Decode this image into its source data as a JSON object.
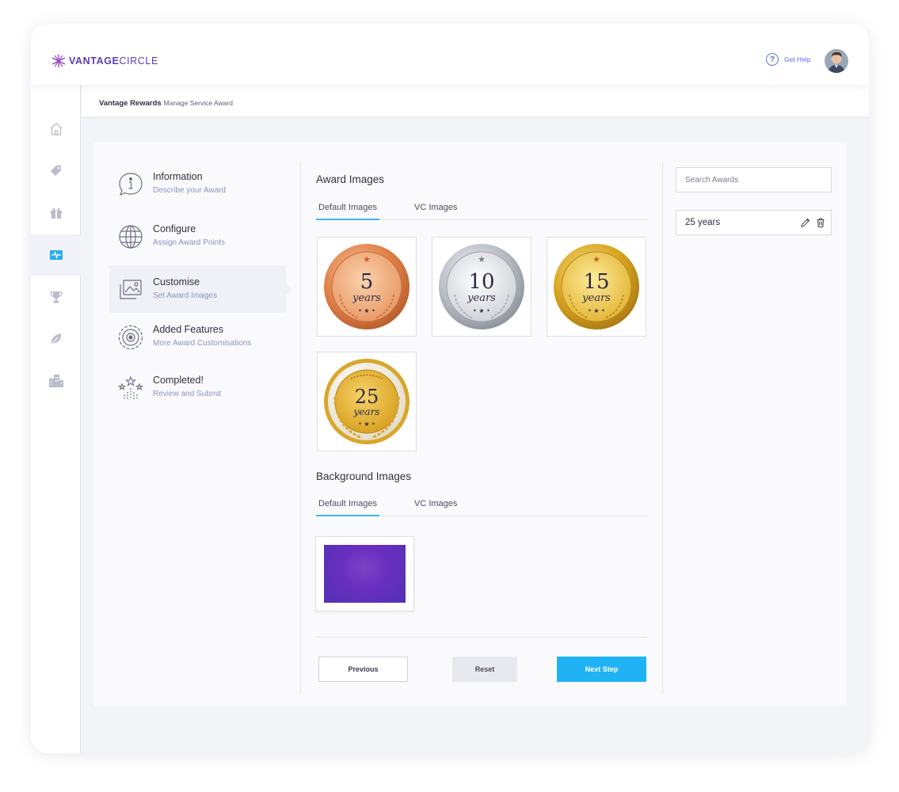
{
  "header": {
    "brand_bold": "VANTAGE",
    "brand_light": "CIRCLE",
    "help_label": "Get Help",
    "help_glyph": "?"
  },
  "breadcrumb": {
    "main": "Vantage Rewards",
    "sub": "Manage Service Award"
  },
  "sidebar": {
    "items": [
      {
        "icon": "home-icon"
      },
      {
        "icon": "tag-icon"
      },
      {
        "icon": "gift-icon"
      },
      {
        "icon": "activity-icon",
        "active": true
      },
      {
        "icon": "trophy-icon"
      },
      {
        "icon": "leaf-icon"
      },
      {
        "icon": "buildings-icon"
      }
    ]
  },
  "steps": [
    {
      "title": "Information",
      "subtitle": "Describe your Award",
      "icon": "info-bubble-icon"
    },
    {
      "title": "Configure",
      "subtitle": "Assign Award Points",
      "icon": "globe-icon"
    },
    {
      "title": "Customise",
      "subtitle": "Set Award Images",
      "icon": "images-icon",
      "active": true
    },
    {
      "title": "Added Features",
      "subtitle": "More Award Customisations",
      "icon": "gear-ring-icon"
    },
    {
      "title": "Completed!",
      "subtitle": "Review and Submit",
      "icon": "celebration-icon"
    }
  ],
  "award_images": {
    "title": "Award Images",
    "tabs": [
      "Default Images",
      "VC Images"
    ],
    "active_tab": "Default Images",
    "medals": [
      {
        "number": "5",
        "caption": "years",
        "style": "bronze"
      },
      {
        "number": "10",
        "caption": "years",
        "style": "silver"
      },
      {
        "number": "15",
        "caption": "years",
        "style": "gold"
      },
      {
        "number": "25",
        "caption": "years",
        "style": "gold-laurel"
      }
    ]
  },
  "background_images": {
    "title": "Background Images",
    "tabs": [
      "Default Images",
      "VC Images"
    ],
    "active_tab": "Default Images"
  },
  "buttons": {
    "previous": "Previous",
    "reset": "Reset",
    "next": "Next Step"
  },
  "right_panel": {
    "search_placeholder": "Search Awards",
    "awards": [
      "25 years"
    ]
  },
  "colors": {
    "brand": "#5b3bb5",
    "accent": "#1fb3f5",
    "tab_underline": "#3db7f0",
    "step_subtitle": "#8b93bf"
  }
}
